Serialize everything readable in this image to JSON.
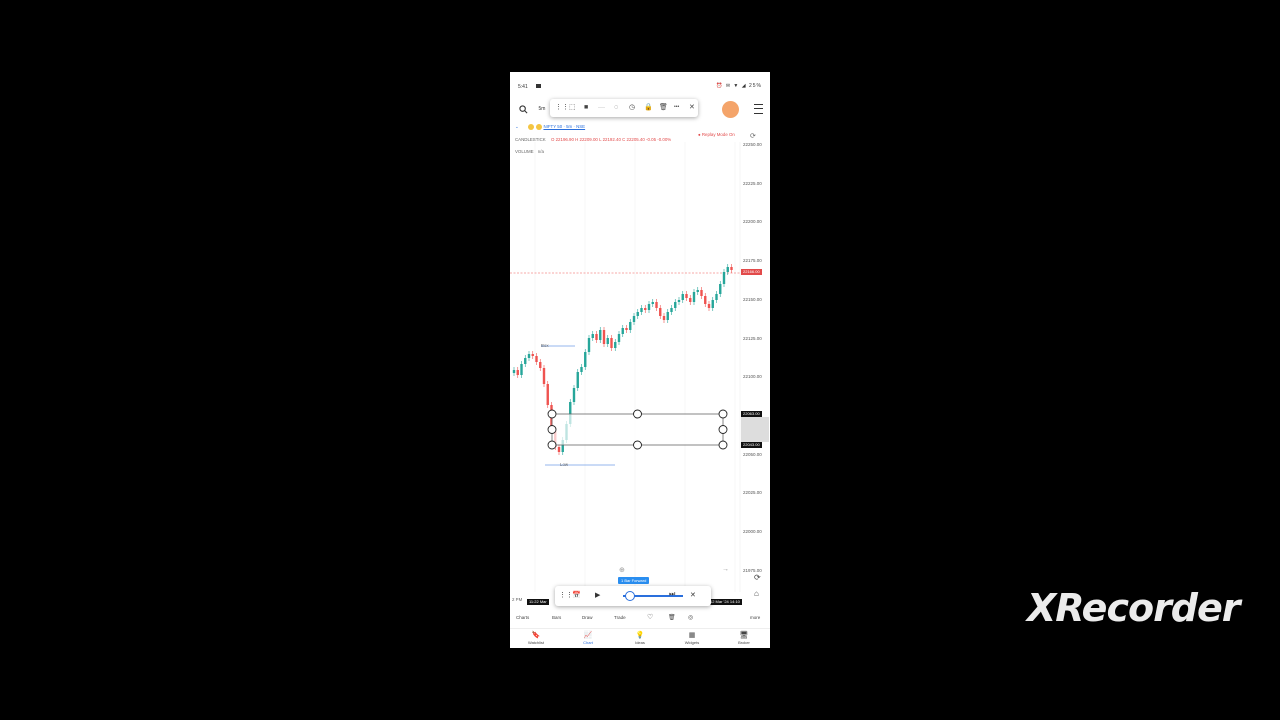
{
  "status_bar": {
    "time": "5:41",
    "icons": "⏰ ✉ ▼ ◢ 25%"
  },
  "topbar": {
    "search_icon": "search-icon",
    "interval": "5m",
    "draw_toolbar": {
      "items": [
        "⋮⋮",
        "⬚",
        "■",
        "—",
        "◌",
        "◷",
        "🔒",
        "🗑",
        "•••",
        "✕"
      ]
    }
  },
  "legend": {
    "symbol": "NIFTY 50 · 5m · NSE",
    "candles_label": "CANDLESTICK",
    "ohlc": "O 22196.90  H 22209.00  L 22192.40  C 22205.40  -0.05  -0.00%",
    "replay_mode": "Replay Mode On",
    "volume_label": "VOLUME",
    "volume_value": "n/a"
  },
  "price_axis": {
    "ticks": [
      "22250.00",
      "22225.00",
      "22200.00",
      "22175.00",
      "22150.00",
      "22125.00",
      "22100.00",
      "22075.00",
      "22050.00",
      "22025.00",
      "22000.00",
      "21975.00"
    ],
    "current_price": "22166.00",
    "rect_top_price": "22063.00",
    "rect_bottom_price": "22043.00"
  },
  "annotations": {
    "box_label": "Box",
    "low_label": "Low"
  },
  "time_axis": {
    "left_label": "2 PM",
    "left_date": "11:22 Mar",
    "right_date": "12 Mar '24 14:10"
  },
  "replay_bar": {
    "badge": "1 Bar Forward",
    "items": [
      "⋮⋮",
      "📅",
      "▶",
      "⏭",
      "✕"
    ],
    "speed": 0.1
  },
  "tools_row": {
    "items": [
      "Charts",
      "Bars",
      "Draw",
      "Trade"
    ],
    "right": "more"
  },
  "navbar": {
    "items": [
      {
        "label": "Watchlist",
        "glyph": "🔖"
      },
      {
        "label": "Chart",
        "glyph": "📈"
      },
      {
        "label": "Ideas",
        "glyph": "💡"
      },
      {
        "label": "Widgets",
        "glyph": "▦"
      },
      {
        "label": "Broker",
        "glyph": "🖥"
      }
    ],
    "active": 1
  },
  "watermark": "XRecorder",
  "colors": {
    "up": "#26a69a",
    "down": "#ef5350",
    "accent": "#2a6fdc",
    "price_line": "#ef5350"
  }
}
